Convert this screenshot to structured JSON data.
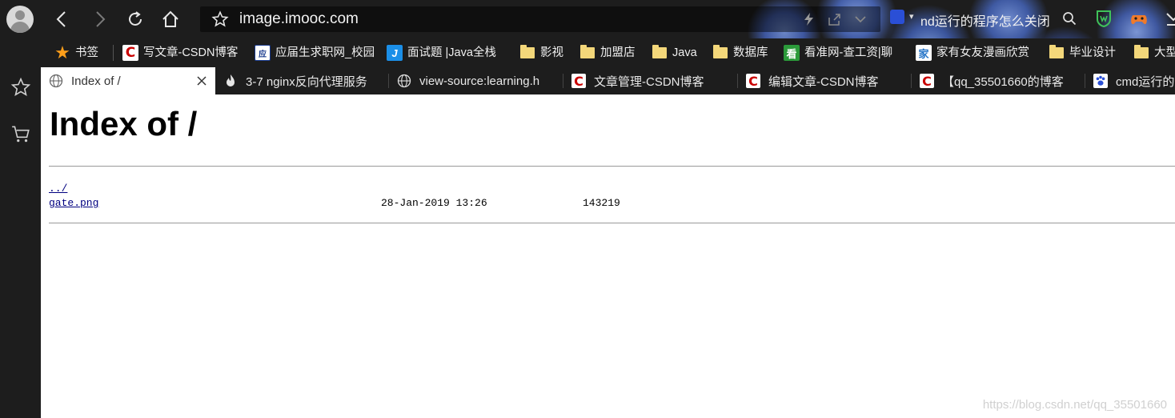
{
  "toolbar": {
    "url": "image.imooc.com",
    "search_text": "nd运行的程序怎么关闭"
  },
  "bookmarks": [
    {
      "label": "书签",
      "icon": "star-icon"
    },
    {
      "label": "写文章-CSDN博客",
      "icon": "csdn-icon"
    },
    {
      "label": "应届生求职网_校园",
      "icon": "yingjiesheng-icon"
    },
    {
      "label": "面试题 |Java全栈",
      "icon": "java-site-icon"
    },
    {
      "label": "影视",
      "icon": "folder-icon"
    },
    {
      "label": "加盟店",
      "icon": "folder-icon"
    },
    {
      "label": "Java",
      "icon": "folder-icon"
    },
    {
      "label": "数据库",
      "icon": "folder-icon"
    },
    {
      "label": "看准网-查工资|聊",
      "icon": "kanzhun-icon"
    },
    {
      "label": "家有女友漫画欣赏",
      "icon": "jiayou-icon"
    },
    {
      "label": "毕业设计",
      "icon": "folder-icon"
    },
    {
      "label": "大型",
      "icon": "folder-icon"
    }
  ],
  "tabs": [
    {
      "label": "Index of /",
      "icon": "globe-icon",
      "active": true
    },
    {
      "label": "3-7 nginx反向代理服务",
      "icon": "flame-icon",
      "active": false
    },
    {
      "label": "view-source:learning.h",
      "icon": "globe-icon",
      "active": false
    },
    {
      "label": "文章管理-CSDN博客",
      "icon": "csdn-icon",
      "active": false
    },
    {
      "label": "编辑文章-CSDN博客",
      "icon": "csdn-icon",
      "active": false
    },
    {
      "label": "【qq_35501660的博客",
      "icon": "csdn-icon",
      "active": false
    },
    {
      "label": "cmd运行的",
      "icon": "baidu-paw-icon",
      "active": false
    }
  ],
  "page": {
    "title": "Index of /",
    "entries": [
      {
        "name": "../",
        "date": "",
        "size": ""
      },
      {
        "name": "gate.png",
        "date": "28-Jan-2019 13:26",
        "size": "143219"
      }
    ]
  },
  "watermark": "https://blog.csdn.net/qq_35501660",
  "colors": {
    "chrome_bg": "#1d1d1d",
    "link": "#000080",
    "csdn_red": "#c90000"
  }
}
